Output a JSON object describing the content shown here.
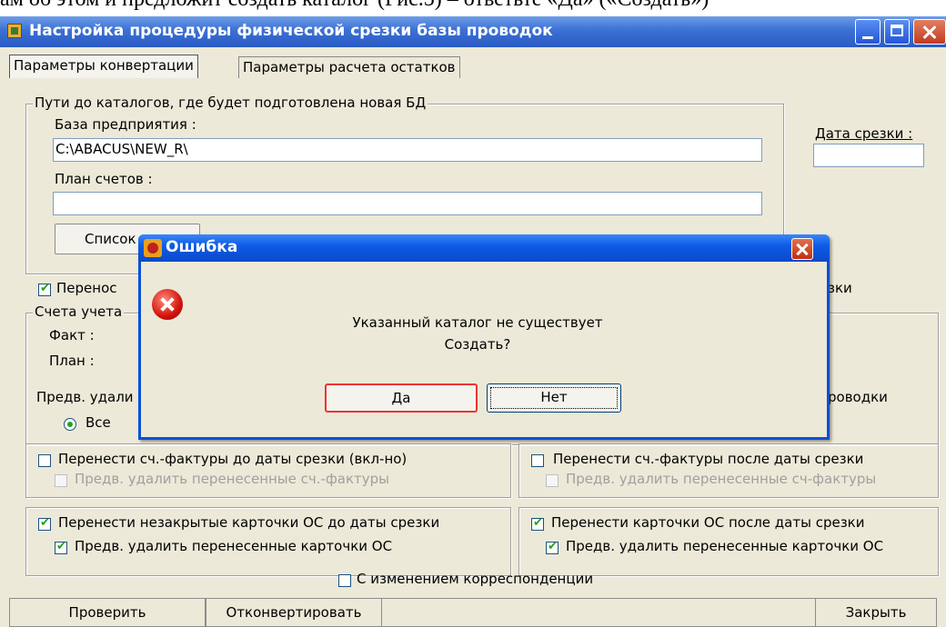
{
  "document_text": "ам об этом и предложит создать каталог (Рис.5) – ответьте «Да» («Создать»)",
  "window": {
    "title": "Настройка процедуры физической срезки базы проводок"
  },
  "tabs": [
    {
      "label": "Параметры конвертации"
    },
    {
      "label": "Параметры расчета остатков"
    }
  ],
  "paths_group": {
    "legend": "Пути до каталогов, где будет подготовлена новая БД",
    "enterprise_label": "База предприятия :",
    "enterprise_value": "C:\\ABACUS\\NEW_R\\",
    "accounts_label": "План счетов :",
    "accounts_value": "",
    "list_button": "Список"
  },
  "date": {
    "label": "Дата срезки :",
    "value": ""
  },
  "transfer": {
    "checkbox_label_partial": "Перенос",
    "right_partial": "зки",
    "accounts_legend": "Счета учета",
    "fact_label": "Факт :",
    "plan_label": "План :",
    "pred_label": "Предв. удали",
    "right_label": "роводки",
    "radio_all": "Все"
  },
  "invoices": {
    "before_label": "Перенести сч.-фактуры до даты срезки (вкл-но)",
    "before_sub": "Предв. удалить перенесенные сч.-фактуры",
    "after_label": "Перенести сч.-фактуры после даты срезки",
    "after_sub": "Предв. удалить перенесенные сч-фактуры"
  },
  "os_cards": {
    "before_label": "Перенести незакрытые карточки ОС до даты срезки",
    "before_sub": "Предв. удалить перенесенные карточки ОС",
    "after_label": "Перенести карточки ОС после даты срезки",
    "after_sub": "Предв. удалить перенесенные карточки ОС"
  },
  "correspondence_label": "С изменением корреспонденции",
  "bottom_buttons": {
    "check": "Проверить",
    "convert": "Отконвертировать",
    "close": "Закрыть"
  },
  "dialog": {
    "title": "Ошибка",
    "message_line1": "Указанный каталог не существует",
    "message_line2": "Создать?",
    "yes": "Да",
    "no": "Нет"
  }
}
